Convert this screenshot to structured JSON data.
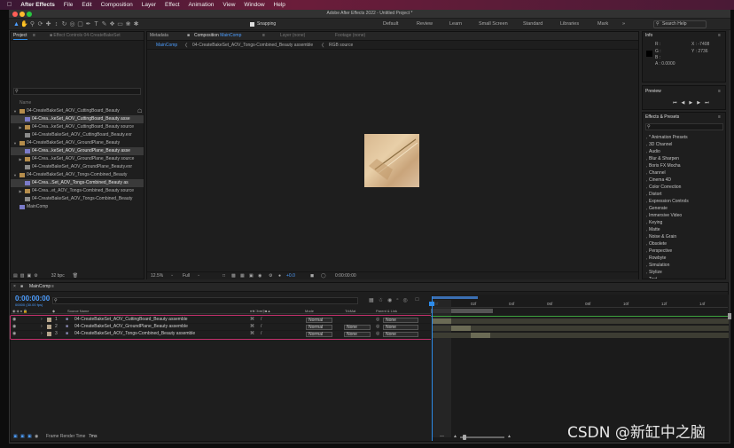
{
  "macmenu": {
    "app": "After Effects",
    "items": [
      "File",
      "Edit",
      "Composition",
      "Layer",
      "Effect",
      "Animation",
      "View",
      "Window",
      "Help"
    ]
  },
  "titlebar": {
    "title": "Adobe After Effects 2022 - Untitled Project *"
  },
  "toolbar": {
    "snapping": "Snapping",
    "workspaces": [
      "Default",
      "Review",
      "Learn",
      "Small Screen",
      "Standard",
      "Libraries",
      "Mark"
    ],
    "search": "Search Help"
  },
  "project": {
    "tabs": [
      "Project",
      "Effect Controls 04-CreateBakeSet"
    ],
    "column_name": "Name",
    "items": [
      {
        "label": "04-CreateBakeSet_AOV_CuttingBoard_Beauty",
        "type": "folder",
        "indent": 0,
        "expanded": true,
        "hl": false
      },
      {
        "label": "04-Crea...keSet_AOV_CuttingBoard_Beauty asse",
        "type": "comp",
        "indent": 1,
        "hl": true
      },
      {
        "label": "04-Crea...keSet_AOV_CuttingBoard_Beauty source",
        "type": "folder",
        "indent": 1,
        "expanded": false,
        "hl": false
      },
      {
        "label": "04-CreateBakeSet_AOV_CuttingBoard_Beauty.exr",
        "type": "file",
        "indent": 1,
        "hl": false
      },
      {
        "label": "04-CreateBakeSet_AOV_GroundPlane_Beauty",
        "type": "folder",
        "indent": 0,
        "expanded": true,
        "hl": false
      },
      {
        "label": "04-Crea...keSet_AOV_GroundPlane_Beauty asse",
        "type": "comp",
        "indent": 1,
        "hl": true
      },
      {
        "label": "04-Crea...keSet_AOV_GroundPlane_Beauty source",
        "type": "folder",
        "indent": 1,
        "expanded": false,
        "hl": false
      },
      {
        "label": "04-CreateBakeSet_AOV_GroundPlane_Beauty.exr",
        "type": "file",
        "indent": 1,
        "hl": false
      },
      {
        "label": "04-CreateBakeSet_AOV_Tongs-Combined_Beauty",
        "type": "folder",
        "indent": 0,
        "expanded": true,
        "hl": false
      },
      {
        "label": "04-Crea...Set_AOV_Tongs-Combined_Beauty as",
        "type": "comp",
        "indent": 1,
        "hl": true
      },
      {
        "label": "04-Crea...et_AOV_Tongs-Combined_Beauty source",
        "type": "folder",
        "indent": 1,
        "expanded": false,
        "hl": false
      },
      {
        "label": "04-CreateBakeSet_AOV_Tongs-Combined_Beauty",
        "type": "file",
        "indent": 1,
        "hl": false
      },
      {
        "label": "MainComp",
        "type": "comp",
        "indent": 0,
        "hl": false
      }
    ],
    "bpc": "32 bpc"
  },
  "viewer": {
    "tabs": [
      "Metadata",
      "Composition",
      "Layer (none)",
      "Footage (none)"
    ],
    "comp_tab_name": "MainComp",
    "breadcrumbs": [
      "MainComp",
      "04-CreateBakeSet_AOV_Tongs-Combined_Beauty assemble",
      "RGB source"
    ],
    "zoom": "12.5%",
    "resolution": "Full",
    "exposure": "+0.0",
    "timecode": "0:00:00:00"
  },
  "info": {
    "title": "Info",
    "r": "R :",
    "g": "G :",
    "b": "B :",
    "a": "A : 0.0000",
    "x": "X : -7408",
    "y": "Y : 2736"
  },
  "preview": {
    "title": "Preview"
  },
  "effects": {
    "title": "Effects & Presets",
    "items": [
      "* Animation Presets",
      "3D Channel",
      "Audio",
      "Blur & Sharpen",
      "Boris FX Mocha",
      "Channel",
      "Cinema 4D",
      "Color Correction",
      "Distort",
      "Expression Controls",
      "Generate",
      "Immersive Video",
      "Keying",
      "Matte",
      "Noise & Grain",
      "Obsolete",
      "Perspective",
      "Rowbyte",
      "Simulation",
      "Stylize",
      "Text"
    ]
  },
  "timeline": {
    "tab": "MainComp",
    "time": "0:00:00:00",
    "frames": "00000 (30.00 fps)",
    "col_source": "Source Name",
    "col_mode": "Mode",
    "col_trkmat": "TrkMat",
    "col_parent": "Parent & Link",
    "ruler": [
      "00f",
      "02f",
      "04f",
      "06f",
      "08f",
      "10f",
      "12f",
      "14f"
    ],
    "layers": [
      {
        "num": "1",
        "name": "04-CreateBakeSet_AOV_CuttingBoard_Beauty assemble",
        "mode": "Normal",
        "trkmat": "",
        "parent": "None"
      },
      {
        "num": "2",
        "name": "04-CreateBakeSet_AOV_GroundPlane_Beauty assemble",
        "mode": "Normal",
        "trkmat": "None",
        "parent": "None"
      },
      {
        "num": "3",
        "name": "04-CreateBakeSet_AOV_Tongs-Combined_Beauty assemble",
        "mode": "Normal",
        "trkmat": "None",
        "parent": "None"
      }
    ],
    "render_time_label": "Frame Render Time",
    "render_time": "7ms"
  },
  "watermark": "CSDN @新缸中之脑",
  "colors": {
    "accent": "#2d8ceb",
    "highlight_box": "#c0306a",
    "green_line": "#3da33d"
  }
}
